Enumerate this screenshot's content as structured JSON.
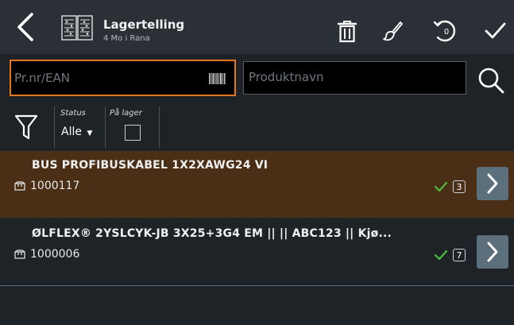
{
  "header": {
    "title": "Lagertelling",
    "subtitle": "4 Mo i Rana",
    "icons": {
      "back": "chevron-left-icon",
      "app": "barcode-grid-icon",
      "delete": "trash-icon",
      "brush": "brush-icon",
      "undo": "undo-icon",
      "undo_badge": "0",
      "confirm": "check-icon"
    }
  },
  "search": {
    "ean_placeholder": "Pr.nr/EAN",
    "ean_value": "",
    "name_placeholder": "Produktnavn",
    "name_value": ""
  },
  "filters": {
    "status_label": "Status",
    "status_value": "Alle",
    "stock_label": "På lager",
    "stock_checked": false
  },
  "items": [
    {
      "title": "BUS PROFIBUSKABEL 1X2XAWG24 VI",
      "code": "1000117",
      "count": "3"
    },
    {
      "title": "ØLFLEX® 2YSLCYK-JB 3X25+3G4 EM ||   || ABC123 || Kjø...",
      "code": "1000006",
      "count": "7"
    }
  ],
  "colors": {
    "accent_orange": "#e2771f",
    "highlight_row": "#4a2e16",
    "check_green": "#4bbf3a",
    "header_bg": "#2a3036"
  }
}
